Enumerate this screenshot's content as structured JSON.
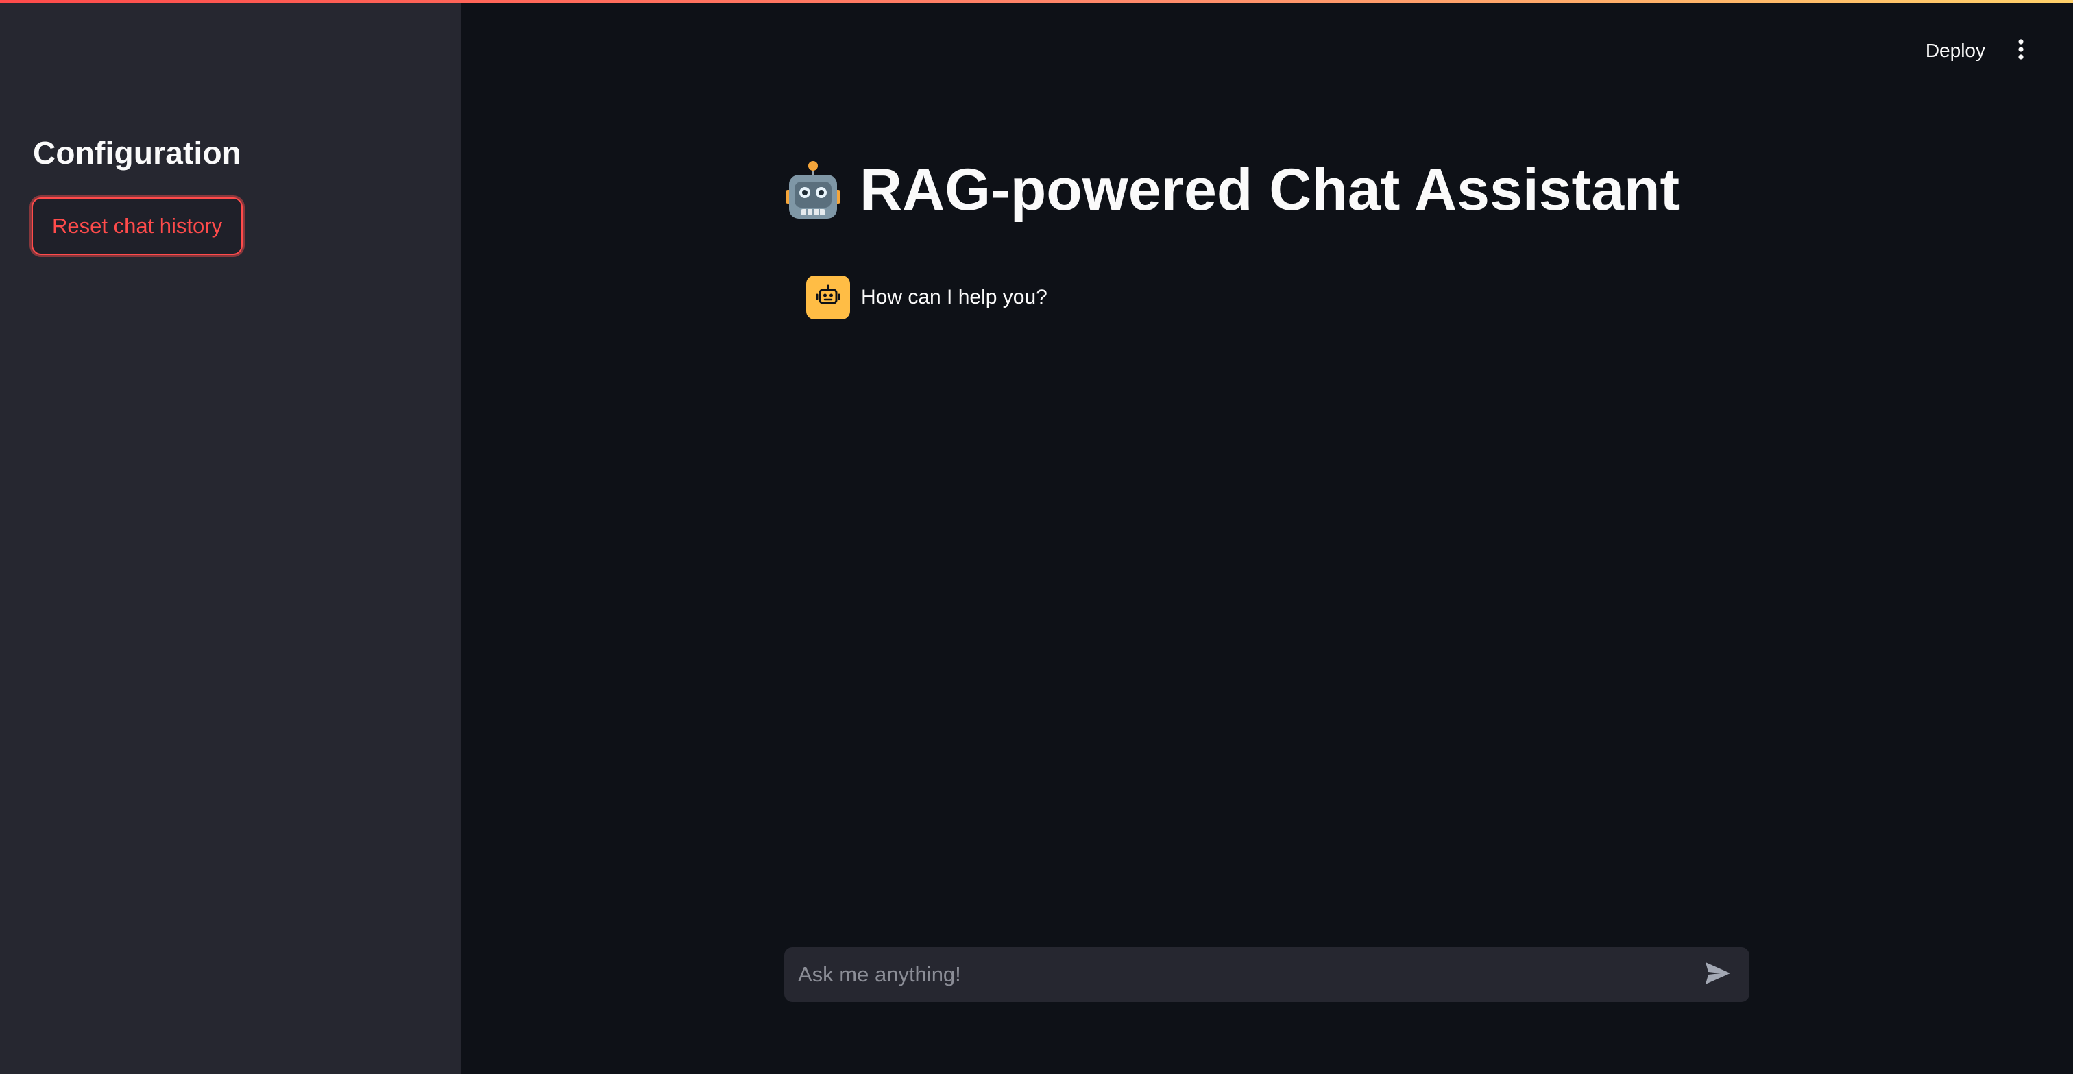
{
  "sidebar": {
    "title": "Configuration",
    "reset_button_label": "Reset chat history"
  },
  "header": {
    "deploy_label": "Deploy",
    "menu_icon": "vertical-dots-icon"
  },
  "main": {
    "title": "RAG-powered Chat Assistant",
    "title_icon": "robot-face-emoji-icon",
    "messages": [
      {
        "role": "assistant",
        "avatar_icon": "robot-icon",
        "text": "How can I help you?"
      }
    ]
  },
  "chat_input": {
    "placeholder": "Ask me anything!",
    "value": "",
    "send_icon": "send-icon"
  },
  "colors": {
    "sidebar_background": "#262730",
    "main_background": "#0e1117",
    "accent": "#ff4b4b",
    "avatar_background": "#ffbd45",
    "input_background": "#262730"
  }
}
